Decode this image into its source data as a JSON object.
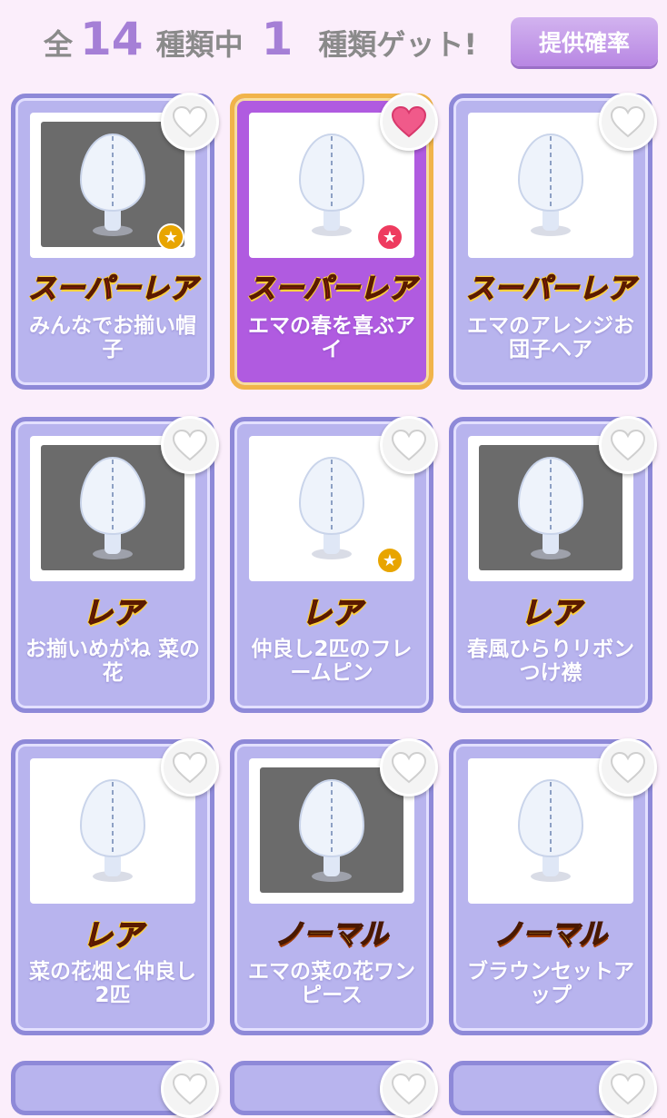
{
  "header": {
    "prefix": "全",
    "total": "14",
    "middle": "種類中",
    "obtained": "1",
    "suffix": "種類ゲット!",
    "rate_button": "提供確率"
  },
  "items": [
    {
      "rarity": "スーパーレア",
      "name": "みんなでお揃い帽子",
      "favorited": false,
      "badge": "gold-star",
      "thumb_bg": "dark"
    },
    {
      "rarity": "スーパーレア",
      "name": "エマの春を喜ぶアイ",
      "favorited": true,
      "badge": "red-star",
      "thumb_bg": "white",
      "selected": true
    },
    {
      "rarity": "スーパーレア",
      "name": "エマのアレンジお団子ヘア",
      "favorited": false,
      "badge": "none",
      "thumb_bg": "white"
    },
    {
      "rarity": "レア",
      "name": "お揃いめがね 菜の花",
      "favorited": false,
      "badge": "none",
      "thumb_bg": "dark"
    },
    {
      "rarity": "レア",
      "name": "仲良し2匹のフレームピン",
      "favorited": false,
      "badge": "gold-star",
      "thumb_bg": "white"
    },
    {
      "rarity": "レア",
      "name": "春風ひらりリボンつけ襟",
      "favorited": false,
      "badge": "none",
      "thumb_bg": "dark"
    },
    {
      "rarity": "レア",
      "name": "菜の花畑と仲良し2匹",
      "favorited": false,
      "badge": "none",
      "thumb_bg": "white"
    },
    {
      "rarity": "ノーマル",
      "name": "エマの菜の花ワンピース",
      "favorited": false,
      "badge": "none",
      "thumb_bg": "dark"
    },
    {
      "rarity": "ノーマル",
      "name": "ブラウンセットアップ",
      "favorited": false,
      "badge": "none",
      "thumb_bg": "white"
    }
  ],
  "colors": {
    "accent": "#a57fd6",
    "card_bg": "#b8b4ee",
    "card_selected_bg": "#b05be0",
    "heart_active": "#f05a8a"
  }
}
